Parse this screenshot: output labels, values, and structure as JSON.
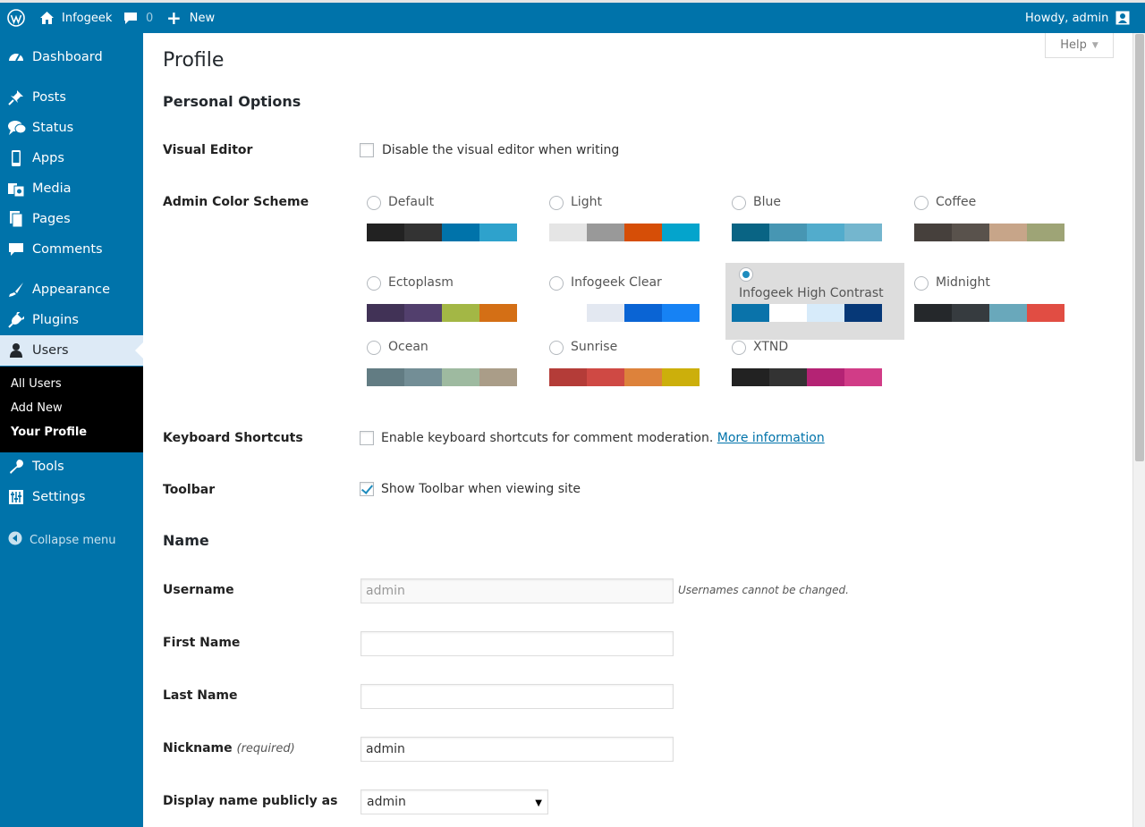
{
  "adminbar": {
    "site_name": "Infogeek",
    "comments_count": "0",
    "new_label": "New",
    "howdy": "Howdy, admin"
  },
  "sidebar": {
    "items": [
      {
        "label": "Dashboard",
        "icon": "dashboard-icon"
      },
      {
        "label": "Posts",
        "icon": "pin-icon"
      },
      {
        "label": "Status",
        "icon": "speech-bubbles-icon"
      },
      {
        "label": "Apps",
        "icon": "phone-icon"
      },
      {
        "label": "Media",
        "icon": "media-icon"
      },
      {
        "label": "Pages",
        "icon": "pages-icon"
      },
      {
        "label": "Comments",
        "icon": "comment-icon"
      },
      {
        "label": "Appearance",
        "icon": "paintbrush-icon"
      },
      {
        "label": "Plugins",
        "icon": "plug-icon"
      },
      {
        "label": "Users",
        "icon": "user-icon"
      },
      {
        "label": "Tools",
        "icon": "wrench-icon"
      },
      {
        "label": "Settings",
        "icon": "sliders-icon"
      }
    ],
    "submenu": [
      "All Users",
      "Add New",
      "Your Profile"
    ],
    "collapse_label": "Collapse menu"
  },
  "main": {
    "help_label": "Help",
    "title": "Profile",
    "personal_options": "Personal Options",
    "visual_editor": {
      "label": "Visual Editor",
      "option": "Disable the visual editor when writing",
      "checked": false
    },
    "color_scheme": {
      "label": "Admin Color Scheme",
      "schemes": [
        {
          "name": "Default",
          "colors": [
            "#222222",
            "#333333",
            "#0073aa",
            "#2ea2cc"
          ],
          "selected": false
        },
        {
          "name": "Light",
          "colors": [
            "#e5e5e5",
            "#999999",
            "#d64e07",
            "#04a4cc"
          ],
          "selected": false
        },
        {
          "name": "Blue",
          "colors": [
            "#096484",
            "#4796b3",
            "#52accc",
            "#74b6ce"
          ],
          "selected": false
        },
        {
          "name": "Coffee",
          "colors": [
            "#46403c",
            "#59524c",
            "#c7a589",
            "#9ea476"
          ],
          "selected": false
        },
        {
          "name": "Ectoplasm",
          "colors": [
            "#413256",
            "#523f6d",
            "#a3b745",
            "#d46f15"
          ],
          "selected": false
        },
        {
          "name": "Infogeek Clear",
          "colors": [
            "#ffffff",
            "#e3e8f1",
            "#0a64d4",
            "#1682f4"
          ],
          "selected": false
        },
        {
          "name": "Infogeek High Contrast",
          "colors": [
            "#0a73aa",
            "#ffffff",
            "#d7ebfa",
            "#063877"
          ],
          "selected": true
        },
        {
          "name": "Midnight",
          "colors": [
            "#25282b",
            "#363b3f",
            "#69a8bb",
            "#e14d43"
          ],
          "selected": false
        },
        {
          "name": "Ocean",
          "colors": [
            "#627c83",
            "#738e96",
            "#9ebaa0",
            "#aa9d88"
          ],
          "selected": false
        },
        {
          "name": "Sunrise",
          "colors": [
            "#b43c38",
            "#cf4944",
            "#dd823b",
            "#ccaf0b"
          ],
          "selected": false
        },
        {
          "name": "XTND",
          "colors": [
            "#222222",
            "#333333",
            "#b42374",
            "#d13c87"
          ],
          "selected": false
        }
      ]
    },
    "keyboard_shortcuts": {
      "label": "Keyboard Shortcuts",
      "option": "Enable keyboard shortcuts for comment moderation.",
      "link": "More information",
      "checked": false
    },
    "toolbar": {
      "label": "Toolbar",
      "option": "Show Toolbar when viewing site",
      "checked": true
    },
    "name_section": "Name",
    "username": {
      "label": "Username",
      "value": "admin",
      "note": "Usernames cannot be changed."
    },
    "first_name": {
      "label": "First Name",
      "value": ""
    },
    "last_name": {
      "label": "Last Name",
      "value": ""
    },
    "nickname": {
      "label": "Nickname",
      "required": "(required)",
      "value": "admin"
    },
    "display_name": {
      "label": "Display name publicly as",
      "value": "admin"
    }
  }
}
